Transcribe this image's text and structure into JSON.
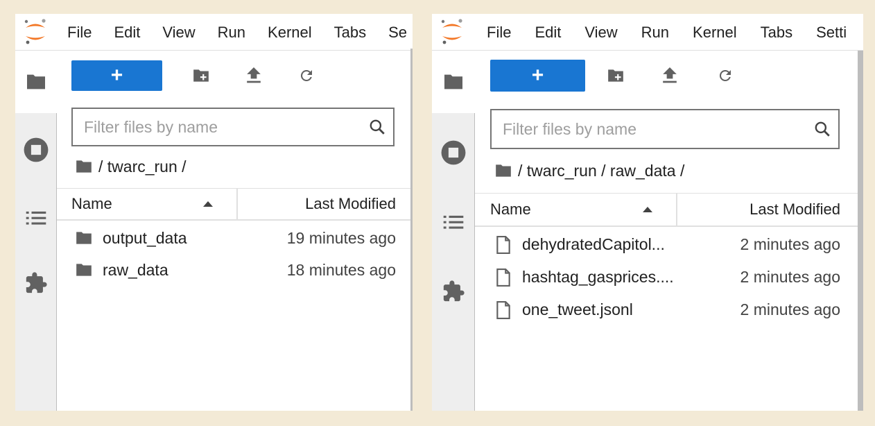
{
  "colors": {
    "accent": "#1976d2",
    "logo": "#f37726",
    "icon": "#616161"
  },
  "left": {
    "menu": [
      "File",
      "Edit",
      "View",
      "Run",
      "Kernel",
      "Tabs",
      "Se"
    ],
    "toolbar": {
      "new_label": "+"
    },
    "filter_placeholder": "Filter files by name",
    "breadcrumb": "/ twarc_run /",
    "columns": {
      "name": "Name",
      "modified": "Last Modified"
    },
    "rows": [
      {
        "type": "folder",
        "name": "output_data",
        "modified": "19 minutes ago"
      },
      {
        "type": "folder",
        "name": "raw_data",
        "modified": "18 minutes ago"
      }
    ]
  },
  "right": {
    "menu": [
      "File",
      "Edit",
      "View",
      "Run",
      "Kernel",
      "Tabs",
      "Setti"
    ],
    "toolbar": {
      "new_label": "+"
    },
    "filter_placeholder": "Filter files by name",
    "breadcrumb": "/ twarc_run / raw_data /",
    "columns": {
      "name": "Name",
      "modified": "Last Modified"
    },
    "rows": [
      {
        "type": "file",
        "name": "dehydratedCapitol...",
        "modified": "2 minutes ago"
      },
      {
        "type": "file",
        "name": "hashtag_gasprices....",
        "modified": "2 minutes ago"
      },
      {
        "type": "file",
        "name": "one_tweet.jsonl",
        "modified": "2 minutes ago"
      }
    ]
  },
  "sidebar_icons": [
    "folder-icon",
    "stop-circle-icon",
    "list-icon",
    "extension-icon"
  ]
}
